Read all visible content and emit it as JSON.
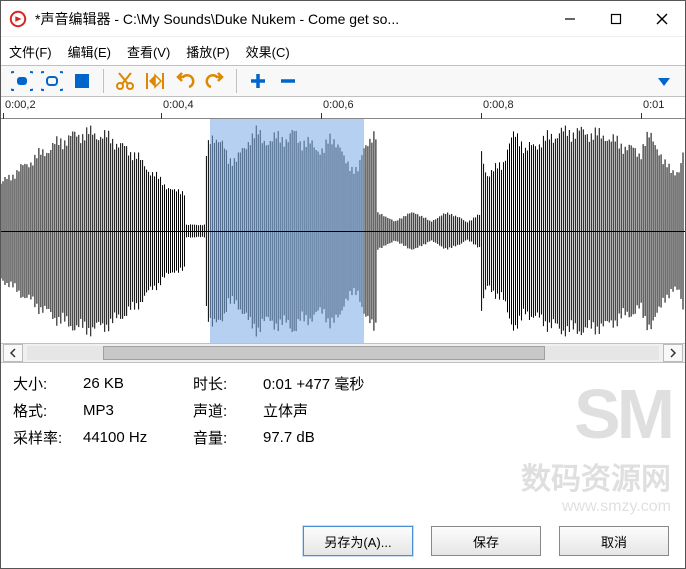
{
  "window": {
    "title": "*声音编辑器 - C:\\My Sounds\\Duke Nukem - Come get so..."
  },
  "menu": {
    "file": "文件(F)",
    "edit": "编辑(E)",
    "view": "查看(V)",
    "play": "播放(P)",
    "effects": "效果(C)"
  },
  "ruler": {
    "ticks": [
      "0:00,2",
      "0:00,4",
      "0:00,6",
      "0:00,8",
      "0:01"
    ]
  },
  "waveform": {
    "selection_start_pct": 30.5,
    "selection_end_pct": 53.0
  },
  "info": {
    "size_label": "大小:",
    "size_value": "26 KB",
    "duration_label": "时长:",
    "duration_value": "0:01 +477 毫秒",
    "format_label": "格式:",
    "format_value": "MP3",
    "channels_label": "声道:",
    "channels_value": "立体声",
    "samplerate_label": "采样率:",
    "samplerate_value": "44100 Hz",
    "volume_label": "音量:",
    "volume_value": "97.7 dB"
  },
  "buttons": {
    "save_as": "另存为(A)...",
    "save": "保存",
    "cancel": "取消"
  },
  "watermark": {
    "brand": "SM",
    "cn": "数码资源网",
    "url": "www.smzy.com"
  }
}
